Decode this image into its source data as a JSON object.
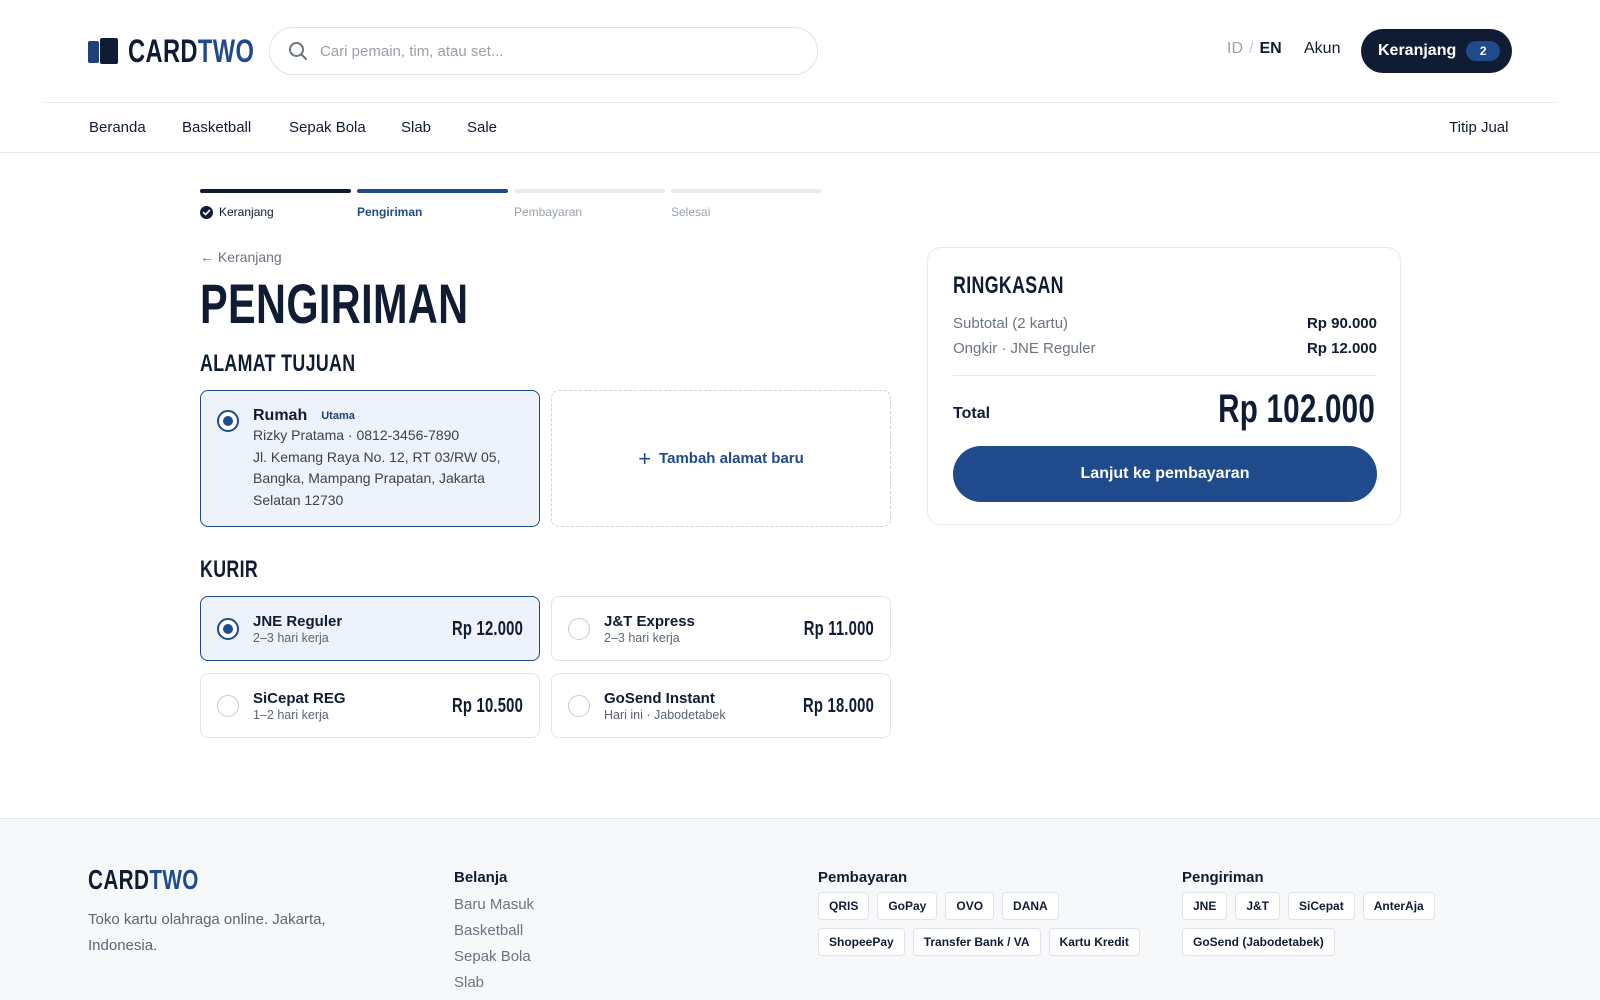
{
  "header": {
    "logo_primary": "CARD",
    "logo_accent": "TWO",
    "search_placeholder": "Cari pemain, tim, atau set...",
    "lang_id": "ID",
    "lang_sep": "/",
    "lang_en": "EN",
    "account": "Akun",
    "cart_label": "Keranjang",
    "cart_count": "2"
  },
  "nav": {
    "items": [
      "Beranda",
      "Basketball",
      "Sepak Bola",
      "Slab",
      "Sale"
    ],
    "right": "Titip Jual"
  },
  "stepper": {
    "steps": [
      {
        "label": "Keranjang",
        "state": "done"
      },
      {
        "label": "Pengiriman",
        "state": "active"
      },
      {
        "label": "Pembayaran",
        "state": "pending"
      },
      {
        "label": "Selesai",
        "state": "pending"
      }
    ]
  },
  "main": {
    "back_label": "← Keranjang",
    "title": "PENGIRIMAN",
    "address_section": "ALAMAT TUJUAN",
    "address": {
      "label": "Rumah",
      "tag": "Utama",
      "recipient": "Rizky Pratama · 0812-3456-7890",
      "line": "Jl. Kemang Raya No. 12, RT 03/RW 05, Bangka, Mampang Prapatan, Jakarta Selatan 12730",
      "selected": true
    },
    "add_address": "Tambah alamat baru",
    "courier_section": "KURIR",
    "couriers": [
      {
        "name": "JNE Reguler",
        "eta": "2–3 hari kerja",
        "price": "Rp 12.000",
        "selected": true
      },
      {
        "name": "J&T Express",
        "eta": "2–3 hari kerja",
        "price": "Rp 11.000",
        "selected": false
      },
      {
        "name": "SiCepat REG",
        "eta": "1–2 hari kerja",
        "price": "Rp 10.500",
        "selected": false
      },
      {
        "name": "GoSend Instant",
        "eta": "Hari ini · Jabodetabek",
        "price": "Rp 18.000",
        "selected": false
      }
    ]
  },
  "summary": {
    "title": "RINGKASAN",
    "subtotal_label": "Subtotal (2 kartu)",
    "subtotal_value": "Rp 90.000",
    "shipping_label": "Ongkir · JNE Reguler",
    "shipping_value": "Rp 12.000",
    "total_label": "Total",
    "total_value": "Rp 102.000",
    "cta": "Lanjut ke pembayaran"
  },
  "footer": {
    "logo_primary": "CARD",
    "logo_accent": "TWO",
    "description": "Toko kartu olahraga online. Jakarta, Indonesia.",
    "shop_title": "Belanja",
    "shop_links": [
      "Baru Masuk",
      "Basketball",
      "Sepak Bola",
      "Slab"
    ],
    "payment_title": "Pembayaran",
    "payment_methods": [
      "QRIS",
      "GoPay",
      "OVO",
      "DANA",
      "ShopeePay",
      "Transfer Bank / VA",
      "Kartu Kredit"
    ],
    "shipping_title": "Pengiriman",
    "shipping_methods": [
      "JNE",
      "J&T",
      "SiCepat",
      "AnterAja",
      "GoSend (Jabodetabek)"
    ]
  },
  "colors": {
    "navy": "#0f1c33",
    "accent_blue": "#1f4a8c",
    "selected_bg": "#eef2fa",
    "muted_text": "#6b7480"
  },
  "icons": [
    "logo-mark-icon",
    "search-icon",
    "check-icon",
    "plus-icon",
    "radio-icon"
  ]
}
